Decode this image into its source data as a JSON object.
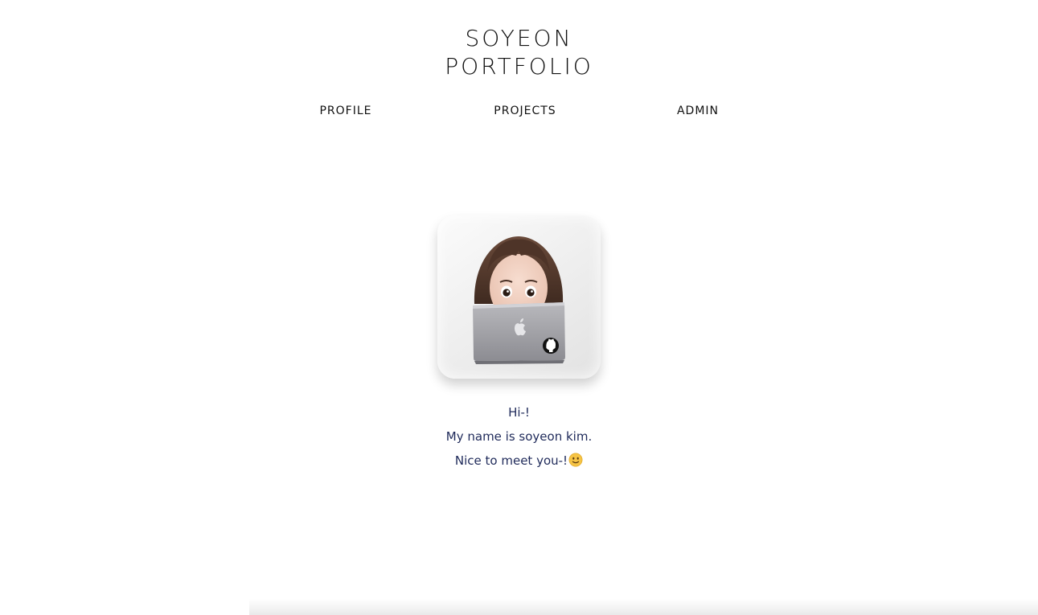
{
  "header": {
    "title_line1": "SOYEON",
    "title_line2": "PORTFOLIO"
  },
  "nav": {
    "items": [
      {
        "label": "PROFILE"
      },
      {
        "label": "PROJECTS"
      },
      {
        "label": "ADMIN"
      }
    ]
  },
  "profile": {
    "avatar_icon": "memoji-with-laptop-icon",
    "greeting_line1": "Hi-!",
    "greeting_line2": "My name is soyeon kim.",
    "greeting_line3": "Nice to meet you-!",
    "emoji_icon": "slightly-smiling-face-icon"
  },
  "colors": {
    "text_dark": "#111111",
    "greeting_text": "#1f2a5a"
  }
}
